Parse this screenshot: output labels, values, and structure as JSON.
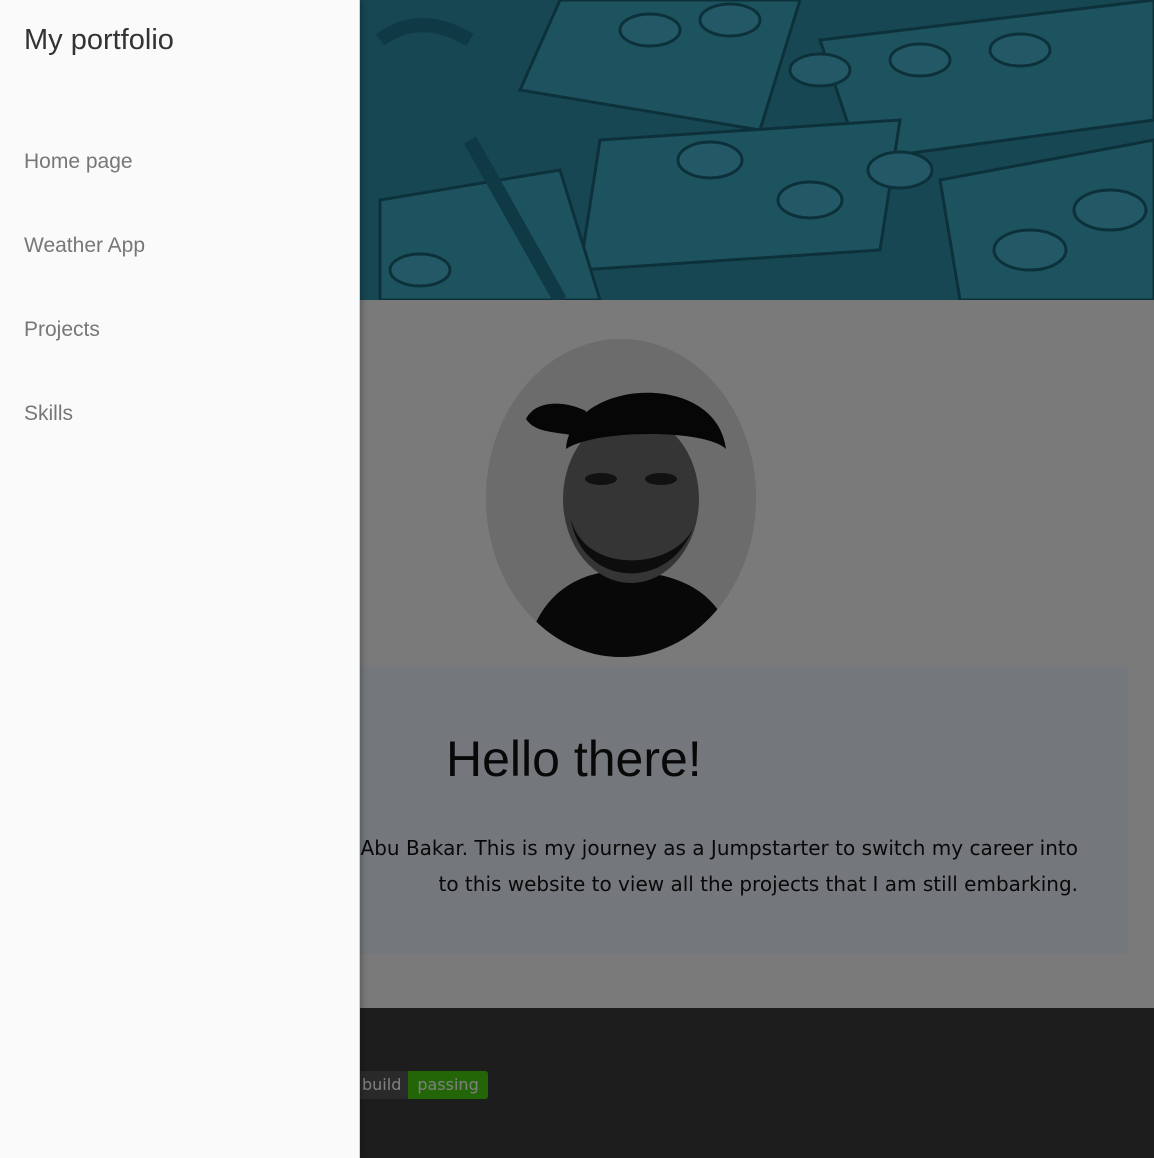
{
  "drawer": {
    "title": "My portfolio",
    "items": [
      {
        "label": "Home page"
      },
      {
        "label": "Weather App"
      },
      {
        "label": "Projects"
      },
      {
        "label": "Skills"
      }
    ]
  },
  "main": {
    "intro": {
      "title": "Hello there!",
      "line1": "Abu Bakar. This is my journey as a Jumpstarter to switch my career into",
      "line2": "to this website to view all the projects that I am still embarking."
    },
    "footer": {
      "badge_left": "build",
      "badge_right": "passing"
    }
  },
  "colors": {
    "drawer_bg": "#fafafa",
    "footer_bg": "#3a3a3a",
    "badge_pass": "#44cc11",
    "hero_teal": "#2b8aa0"
  }
}
